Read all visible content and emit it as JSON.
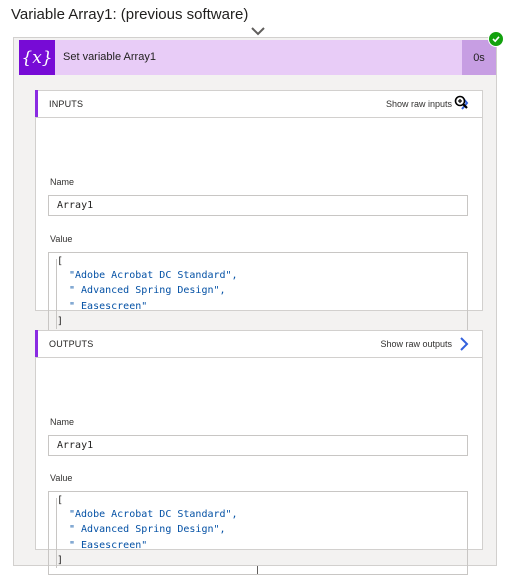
{
  "page_title": "Variable Array1: (previous software)",
  "action": {
    "icon": "variable-icon",
    "icon_text": "{x}",
    "title": "Set variable Array1",
    "duration": "0s",
    "status": "succeeded",
    "status_icon": "success-check-icon"
  },
  "inputs": {
    "label": "INPUTS",
    "raw_link": "Show raw inputs",
    "raw_icon": "zoom-cursor-icon",
    "name_label": "Name",
    "name_value": "Array1",
    "value_label": "Value",
    "value_lines": {
      "open": "[",
      "items": [
        "\"Adobe Acrobat DC Standard\",",
        "\" Advanced Spring Design\",",
        "\" Easescreen\""
      ],
      "close": "]"
    }
  },
  "outputs": {
    "label": "OUTPUTS",
    "raw_link": "Show raw outputs",
    "raw_icon": "chevron-right-icon",
    "name_label": "Name",
    "name_value": "Array1",
    "value_label": "Value",
    "value_lines": {
      "open": "[",
      "items": [
        "\"Adobe Acrobat DC Standard\",",
        "\" Advanced Spring Design\",",
        "\" Easescreen\""
      ],
      "close": "]"
    }
  },
  "colors": {
    "header_bg": "#e8ccf7",
    "icon_bg": "#770bd6",
    "duration_bg": "#c79ee3",
    "success": "#13a10e",
    "string_text": "#0451a5"
  }
}
